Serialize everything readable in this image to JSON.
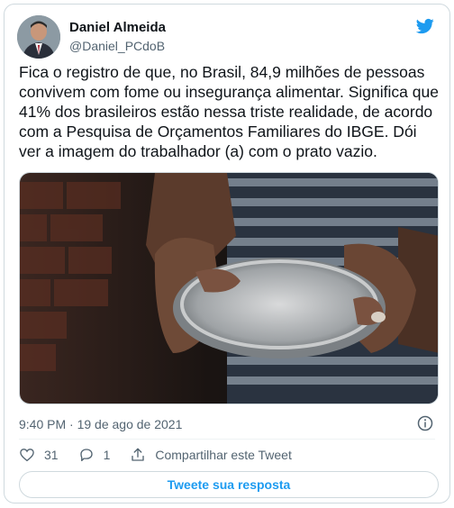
{
  "author": {
    "name": "Daniel Almeida",
    "handle": "@Daniel_PCdoB"
  },
  "tweet": {
    "text": "Fica o registro de que, no Brasil, 84,9 milhões de pessoas convivem com fome ou insegurança alimentar. Significa que 41% dos brasileiros estão nessa triste realidade, de acordo com a Pesquisa de Orçamentos Familiares do IBGE. Dói ver a imagem do trabalhador (a) com o prato vazio.",
    "timestamp": "9:40 PM · 19 de ago de 2021"
  },
  "actions": {
    "likes": "31",
    "replies": "1",
    "share_label": "Compartilhar este Tweet"
  },
  "reply_button_label": "Tweete sua resposta",
  "colors": {
    "accent": "#1d9bf0",
    "text": "#0f1419",
    "secondary": "#536471",
    "border": "#cfd9de"
  },
  "icons": [
    "twitter-bird-icon",
    "info-icon",
    "heart-icon",
    "reply-icon",
    "share-icon"
  ]
}
